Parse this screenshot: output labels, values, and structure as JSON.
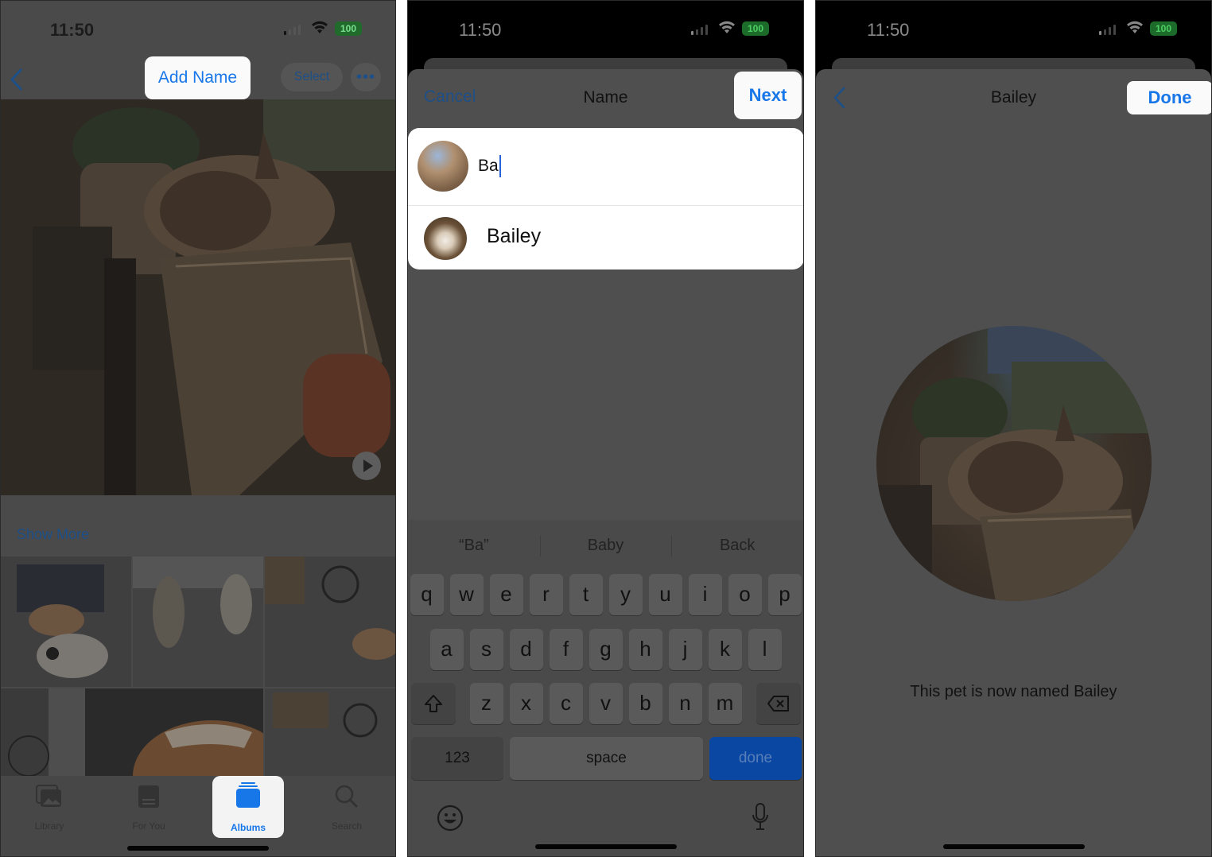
{
  "status_bar": {
    "time": "11:50",
    "battery": "100"
  },
  "panel1": {
    "nav": {
      "add_name_label": "Add Name",
      "select_label": "Select",
      "more_label": "•••"
    },
    "show_more_label": "Show More",
    "tabs": [
      {
        "label": "Library",
        "icon": "photo-library-icon"
      },
      {
        "label": "For You",
        "icon": "for-you-icon"
      },
      {
        "label": "Albums",
        "icon": "albums-icon",
        "selected": true
      },
      {
        "label": "Search",
        "icon": "search-icon"
      }
    ]
  },
  "panel2": {
    "nav": {
      "cancel_label": "Cancel",
      "title": "Name",
      "next_label": "Next"
    },
    "input_value": "Ba",
    "suggestion_name": "Bailey",
    "keyboard": {
      "predictions": [
        "“Ba”",
        "Baby",
        "Back"
      ],
      "row1": [
        "q",
        "w",
        "e",
        "r",
        "t",
        "y",
        "u",
        "i",
        "o",
        "p"
      ],
      "row2": [
        "a",
        "s",
        "d",
        "f",
        "g",
        "h",
        "j",
        "k",
        "l"
      ],
      "row3": [
        "z",
        "x",
        "c",
        "v",
        "b",
        "n",
        "m"
      ],
      "numbers_label": "123",
      "space_label": "space",
      "done_label": "done"
    }
  },
  "panel3": {
    "nav": {
      "title": "Bailey",
      "done_label": "Done"
    },
    "message": "This pet is now named Bailey"
  },
  "colors": {
    "accent": "#1877e8",
    "battery": "#1d6b2a",
    "done_key": "#0a47a3"
  }
}
